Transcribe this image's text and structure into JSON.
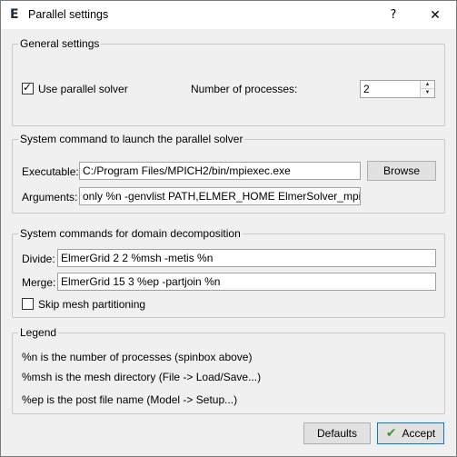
{
  "window": {
    "title": "Parallel settings",
    "icon_letter": "E",
    "help_glyph": "?",
    "close_glyph": "✕"
  },
  "general": {
    "group_title": "General settings",
    "use_parallel_label": "Use parallel solver",
    "use_parallel_checked": true,
    "processes_label": "Number of processes:",
    "processes_value": "2"
  },
  "launch": {
    "group_title": "System command to launch the parallel solver",
    "executable_label": "Executable:",
    "executable_value": "C:/Program Files/MPICH2/bin/mpiexec.exe",
    "browse_label": "Browse",
    "arguments_label": "Arguments:",
    "arguments_value": "only %n -genvlist PATH,ELMER_HOME ElmerSolver_mpi.exe"
  },
  "decomposition": {
    "group_title": "System commands for domain decomposition",
    "divide_label": "Divide:",
    "divide_value": "ElmerGrid 2 2 %msh -metis %n",
    "merge_label": "Merge:",
    "merge_value": "ElmerGrid 15 3 %ep -partjoin %n",
    "skip_label": "Skip mesh partitioning",
    "skip_checked": false
  },
  "legend": {
    "group_title": "Legend",
    "lines": [
      "%n is the number of processes (spinbox above)",
      "%msh is the mesh directory (File -> Load/Save...)",
      "%ep is the post file name (Model -> Setup...)"
    ]
  },
  "buttons": {
    "defaults_label": "Defaults",
    "accept_label": "Accept"
  }
}
